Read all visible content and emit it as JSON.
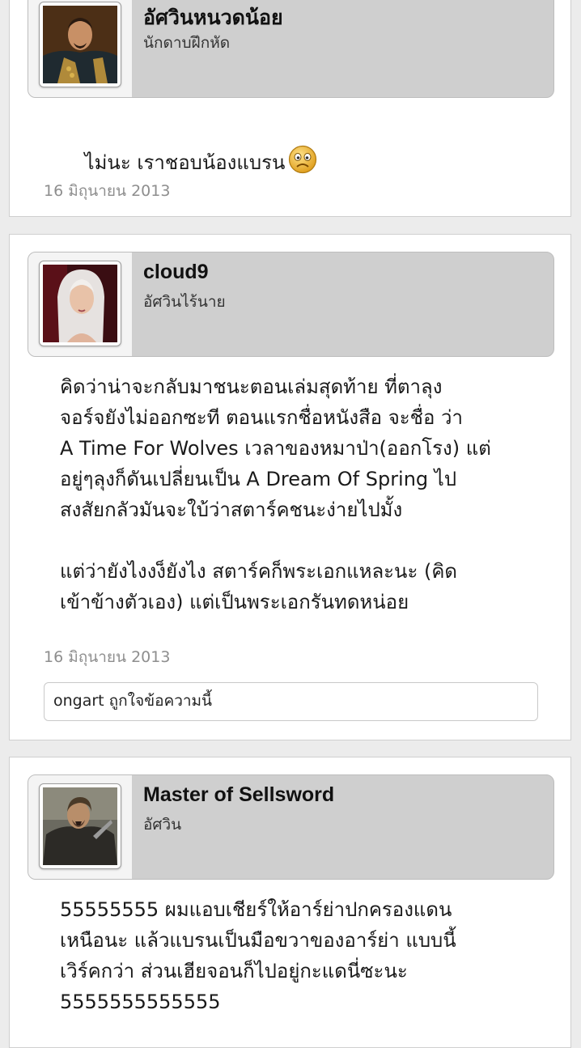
{
  "posts": [
    {
      "author_name": "อัศวินหนวดน้อย",
      "author_rank": "นักดาบฝึกหัด",
      "message": "ไม่นะ เราชอบน้องแบรน",
      "emoji": "sad-face",
      "date": "16 มิถุนายน 2013"
    },
    {
      "author_name": "cloud9",
      "author_rank": "อัศวินไร้นาย",
      "message": "คิดว่าน่าจะกลับมาชนะตอนเล่มสุดท้าย ที่ตาลุง\nจอร์จยังไม่ออกซะที ตอนแรกชื่อหนังสือ จะชื่อ ว่า\nA Time For Wolves เวลาของหมาป่า(ออกโรง) แต่\nอยู่ๆลุงก็ดันเปลี่ยนเป็น A Dream Of Spring ไป\nสงสัยกลัวมันจะใบ้ว่าสตาร์คชนะง่ายไปมั้ง\n\nแต่ว่ายังไงงง็ยังไง สตาร์คก็พระเอกแหละนะ (คิด\nเข้าข้างตัวเอง) แต่เป็นพระเอกรันทดหน่อย",
      "date": "16 มิถุนายน 2013",
      "like_text": "ongart ถูกใจข้อความนี้"
    },
    {
      "author_name": "Master of Sellsword",
      "author_rank": "อัศวิน",
      "message": "55555555 ผมแอบเชียร์ให้อาร์ย่าปกครองแดน\nเหนือนะ แล้วแบรนเป็นมือขวาของอาร์ย่า แบบนี้\nเวิร์คกว่า ส่วนเฮียจอนก็ไปอยู่กะแดนี่ซะนะ\n5555555555555"
    }
  ]
}
